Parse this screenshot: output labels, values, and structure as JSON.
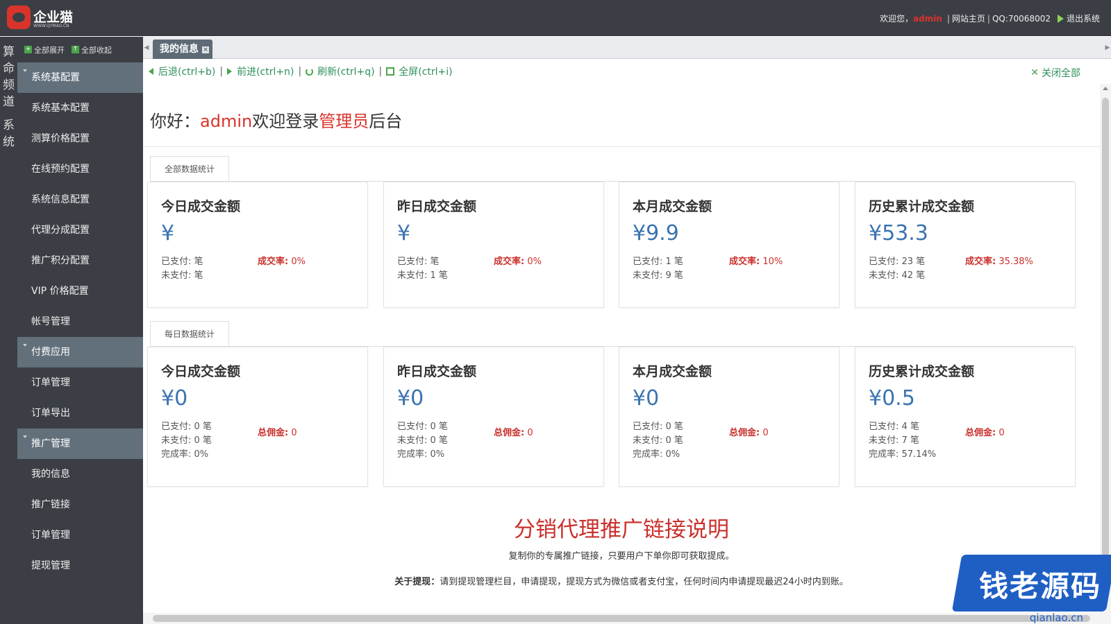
{
  "header": {
    "logo_name": "企业猫",
    "logo_sub": "WWW.QYMAO.CN",
    "welcome": "欢迎您，",
    "user": "admin",
    "site_home": "网站主页",
    "qq": "QQ:70068002",
    "logout": "退出系统"
  },
  "vertical_strip": [
    "算命频道",
    "系统"
  ],
  "sidebar": {
    "expand_all": "全部展开",
    "collapse_all": "全部收起",
    "groups": [
      {
        "label": "系统基配置",
        "items": [
          "系统基本配置",
          "测算价格配置",
          "在线预约配置",
          "系统信息配置",
          "代理分成配置",
          "推广积分配置",
          "VIP 价格配置",
          "帐号管理"
        ]
      },
      {
        "label": "付费应用",
        "items": [
          "订单管理",
          "订单导出"
        ]
      },
      {
        "label": "推广管理",
        "items": [
          "我的信息",
          "推广链接",
          "订单管理",
          "提现管理"
        ]
      }
    ]
  },
  "tabs": {
    "active": "我的信息"
  },
  "toolbar": {
    "back": "后退(ctrl+b)",
    "forward": "前进(ctrl+n)",
    "refresh": "刷新(ctrl+q)",
    "fullscreen": "全屏(ctrl+i)",
    "close_all": "关闭全部"
  },
  "greeting": {
    "prefix": "你好：",
    "user": "admin",
    "middle": "欢迎登录",
    "role": "管理员",
    "suffix": "后台"
  },
  "sections": [
    {
      "tab": "全部数据统计",
      "cards": [
        {
          "title": "今日成交金额",
          "amount": "¥",
          "paid": "已支付: 笔",
          "unpaid": "未支付: 笔",
          "rate_label": "成交率:",
          "rate_value": "0%"
        },
        {
          "title": "昨日成交金额",
          "amount": "¥",
          "paid": "已支付: 笔",
          "unpaid": "未支付: 1 笔",
          "rate_label": "成交率:",
          "rate_value": "0%"
        },
        {
          "title": "本月成交金额",
          "amount": "¥9.9",
          "paid": "已支付: 1 笔",
          "unpaid": "未支付: 9 笔",
          "rate_label": "成交率:",
          "rate_value": "10%"
        },
        {
          "title": "历史累计成交金额",
          "amount": "¥53.3",
          "paid": "已支付: 23 笔",
          "unpaid": "未支付: 42 笔",
          "rate_label": "成交率:",
          "rate_value": "35.38%"
        }
      ]
    },
    {
      "tab": "每日数据统计",
      "cards": [
        {
          "title": "今日成交金额",
          "amount": "¥0",
          "paid": "已支付: 0 笔",
          "unpaid": "未支付: 0 笔",
          "completion": "完成率: 0%",
          "rate_label": "总佣金:",
          "rate_value": "0"
        },
        {
          "title": "昨日成交金额",
          "amount": "¥0",
          "paid": "已支付: 0 笔",
          "unpaid": "未支付: 0 笔",
          "completion": "完成率: 0%",
          "rate_label": "总佣金:",
          "rate_value": "0"
        },
        {
          "title": "本月成交金额",
          "amount": "¥0",
          "paid": "已支付: 0 笔",
          "unpaid": "未支付: 0 笔",
          "completion": "完成率: 0%",
          "rate_label": "总佣金:",
          "rate_value": "0"
        },
        {
          "title": "历史累计成交金额",
          "amount": "¥0.5",
          "paid": "已支付: 4 笔",
          "unpaid": "未支付: 7 笔",
          "completion": "完成率: 57.14%",
          "rate_label": "总佣金:",
          "rate_value": "0"
        }
      ]
    }
  ],
  "promo": {
    "title": "分销代理推广链接说明",
    "desc": "复制你的专属推广链接，只要用户下单你即可获取提成。",
    "note_label": "关于提现：",
    "note_text": "请到提现管理栏目，申请提现，提现方式为微信或者支付宝，任何时间内申请提现最迟24小时内到账。"
  },
  "watermark": {
    "text": "钱老源码",
    "url": "qianlao.cn"
  }
}
